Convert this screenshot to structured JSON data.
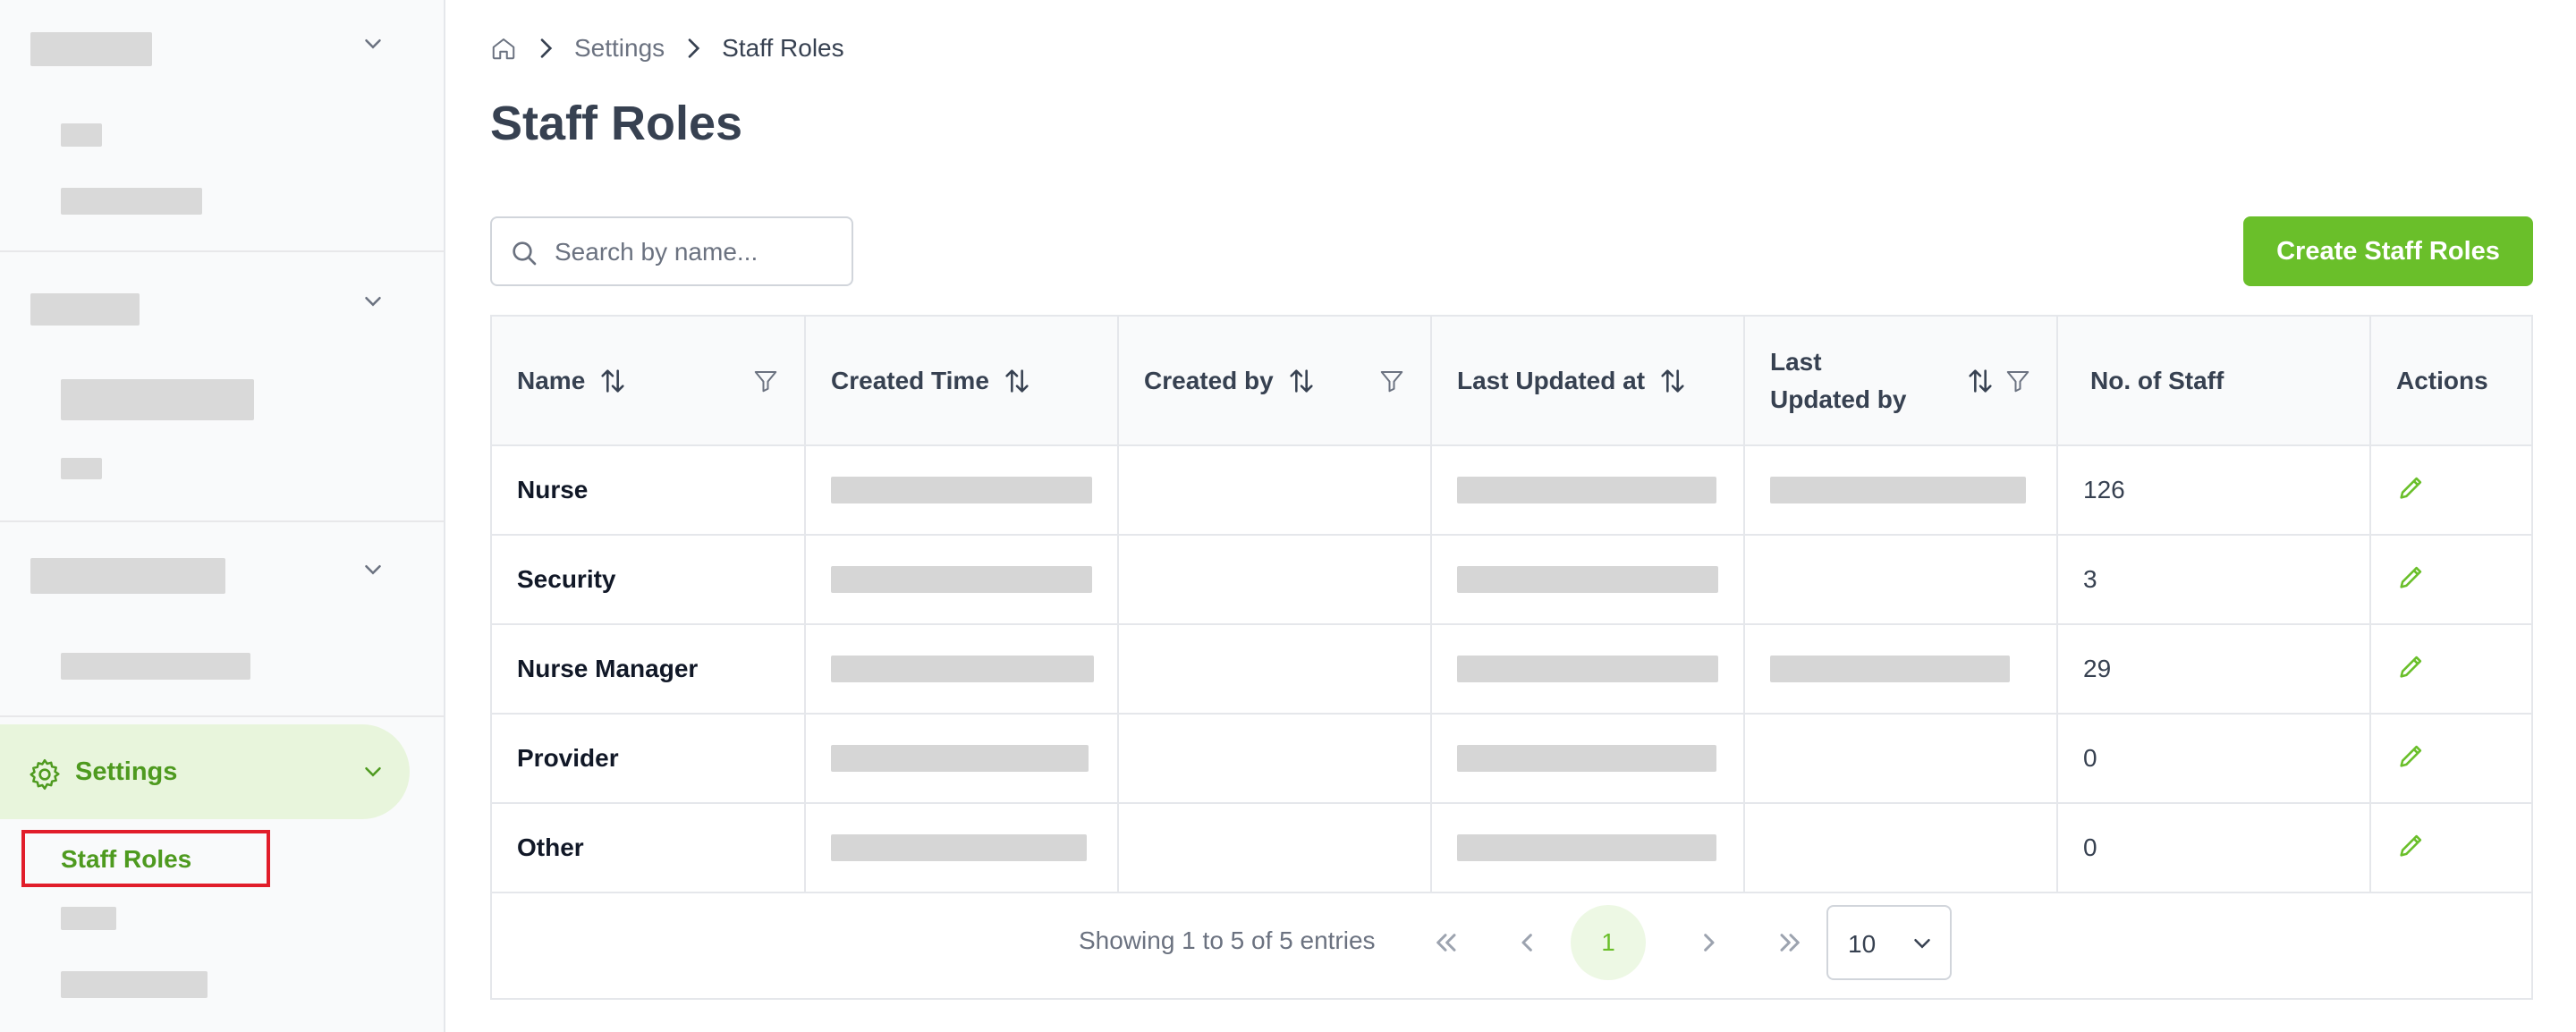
{
  "breadcrumb": {
    "home_icon": "home-icon",
    "items": [
      "Settings",
      "Staff Roles"
    ]
  },
  "sidebar": {
    "active_section": "Settings",
    "active_item": "Staff Roles",
    "accent_color": "#4e9a1f",
    "highlight_color": "#e11d2a"
  },
  "page": {
    "title": "Staff Roles"
  },
  "search": {
    "placeholder": "Search by name...",
    "value": ""
  },
  "toolbar": {
    "create_label": "Create Staff Roles",
    "create_color": "#6abf2a"
  },
  "table": {
    "columns": [
      {
        "label": "Name",
        "sortable": true,
        "filterable": true
      },
      {
        "label": "Created Time",
        "sortable": true,
        "filterable": false
      },
      {
        "label": "Created by",
        "sortable": true,
        "filterable": true
      },
      {
        "label": "Last Updated at",
        "sortable": true,
        "filterable": false
      },
      {
        "label": "Last\nUpdated by",
        "sortable": true,
        "filterable": true
      },
      {
        "label": "No. of Staff",
        "sortable": false,
        "filterable": false
      },
      {
        "label": "Actions",
        "sortable": false,
        "filterable": false
      }
    ],
    "rows": [
      {
        "name": "Nurse",
        "staff_count": "126"
      },
      {
        "name": "Security",
        "staff_count": "3"
      },
      {
        "name": "Nurse Manager",
        "staff_count": "29"
      },
      {
        "name": "Provider",
        "staff_count": "0"
      },
      {
        "name": "Other",
        "staff_count": "0"
      }
    ]
  },
  "pagination": {
    "summary": "Showing 1 to 5 of 5 entries",
    "current_page": "1",
    "page_size": "10"
  }
}
